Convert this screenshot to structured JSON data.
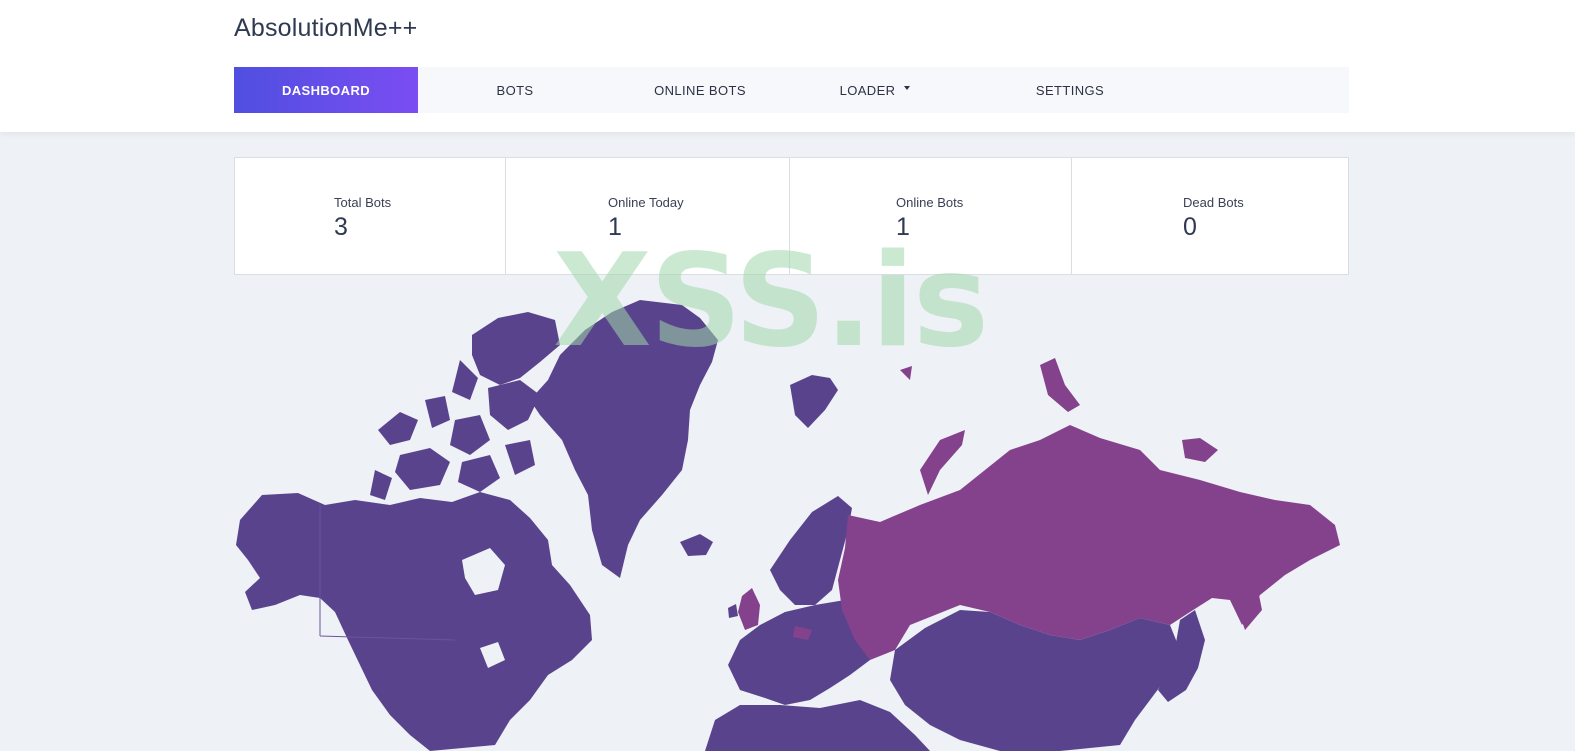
{
  "app": {
    "title": "AbsolutionMe++"
  },
  "nav": {
    "items": [
      {
        "label": "DASHBOARD",
        "active": true
      },
      {
        "label": "BOTS"
      },
      {
        "label": "ONLINE BOTS"
      },
      {
        "label": "LOADER"
      },
      {
        "label": "SETTINGS"
      }
    ]
  },
  "stats": [
    {
      "label": "Total Bots",
      "value": "3"
    },
    {
      "label": "Online Today",
      "value": "1"
    },
    {
      "label": "Online Bots",
      "value": "1"
    },
    {
      "label": "Dead Bots",
      "value": "0"
    }
  ],
  "watermark": "XSS.is",
  "map": {
    "base_color": "#5a438d",
    "highlight_color": "#84428d",
    "highlighted_regions": [
      "Russia",
      "United Kingdom"
    ]
  }
}
